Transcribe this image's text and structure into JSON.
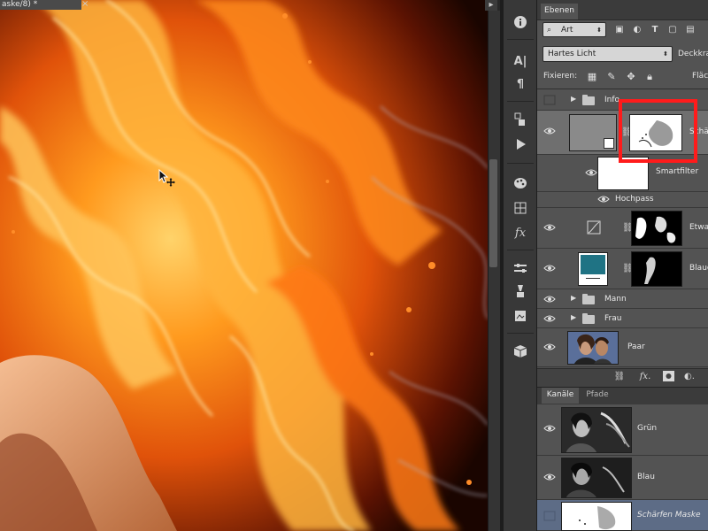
{
  "document": {
    "tab_title": "aske/8) *",
    "close_glyph": "×"
  },
  "toolstrip": {
    "icons": [
      "info-icon",
      "character-icon",
      "paragraph-icon",
      "history-icon",
      "actions-play-icon",
      "brushes-palette-icon",
      "swatches-icon",
      "styles-fx-icon",
      "adjustments-icon",
      "tool-presets-icon",
      "3d-icon"
    ]
  },
  "layers_panel": {
    "tab_label": "Ebenen",
    "filter": {
      "value": "Art",
      "icons": [
        "image-filter-icon",
        "adjustment-filter-icon",
        "type-filter-icon",
        "shape-filter-icon",
        "smartobject-filter-icon"
      ]
    },
    "blend_mode": "Hartes Licht",
    "opacity_label": "Deckkra",
    "lock_label": "Fixieren:",
    "fill_label": "Fläc",
    "layers": [
      {
        "name": "Info",
        "type": "group",
        "visible": false
      },
      {
        "name": "Schä",
        "type": "smart-object",
        "visible": true,
        "selected": true
      },
      {
        "name": "Smartfilter",
        "type": "smart-filter",
        "visible": true
      },
      {
        "name": "Hochpass",
        "type": "filter",
        "visible": true
      },
      {
        "name": "Etwa",
        "type": "adjustment",
        "visible": true
      },
      {
        "name": "Blaue",
        "type": "solid-color",
        "visible": true,
        "color": "#1f7384"
      },
      {
        "name": "Mann",
        "type": "group",
        "visible": true
      },
      {
        "name": "Frau",
        "type": "group",
        "visible": true
      },
      {
        "name": "Paar",
        "type": "image",
        "visible": true
      }
    ],
    "footer_icons": [
      "link-icon",
      "fx-icon",
      "mask-icon",
      "adjustment-icon"
    ]
  },
  "channels_panel": {
    "tabs": [
      "Kanäle",
      "Pfade"
    ],
    "channels": [
      {
        "name": "Grün",
        "visible": true
      },
      {
        "name": "Blau",
        "visible": true
      },
      {
        "name": "Schärfen Maske",
        "visible": false,
        "selected": true
      }
    ]
  },
  "highlight_color": "#ff1b1b"
}
